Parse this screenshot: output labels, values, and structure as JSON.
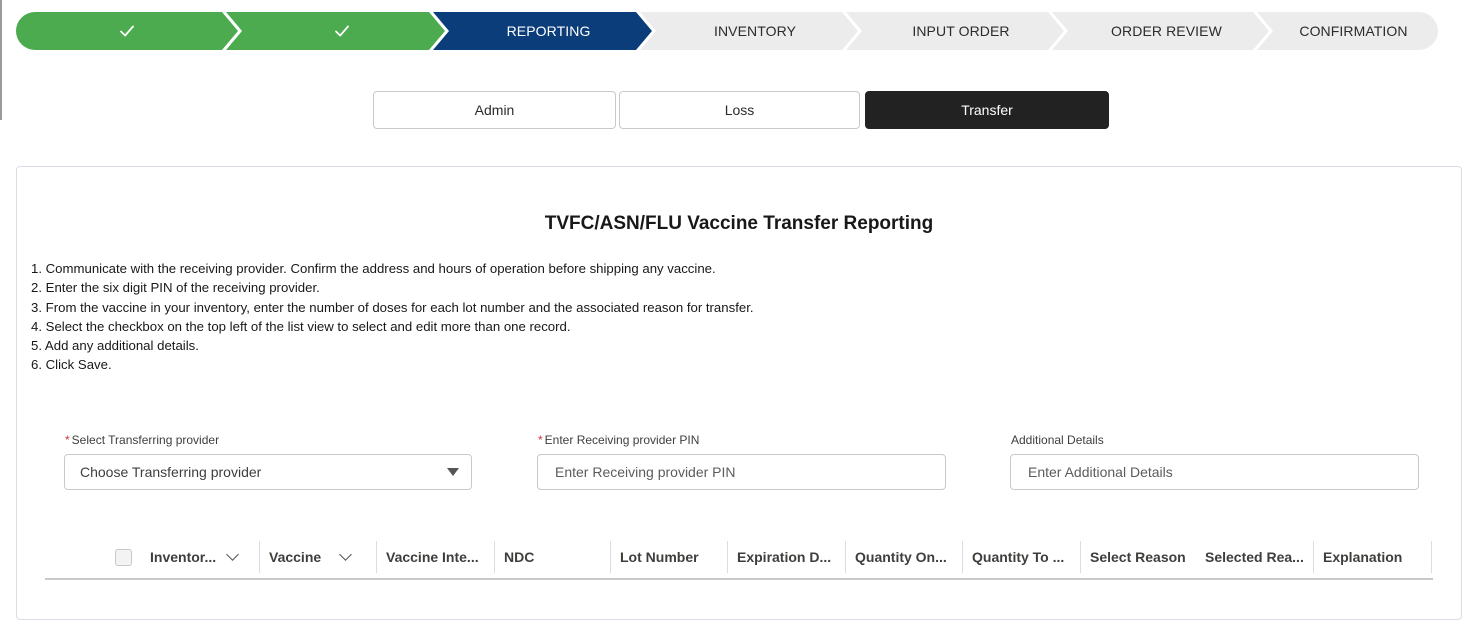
{
  "path": {
    "stages": [
      {
        "label": "",
        "status": "complete",
        "icon": "check-icon"
      },
      {
        "label": "",
        "status": "complete",
        "icon": "check-icon"
      },
      {
        "label": "REPORTING",
        "status": "current"
      },
      {
        "label": "INVENTORY",
        "status": "incomplete"
      },
      {
        "label": "INPUT ORDER",
        "status": "incomplete"
      },
      {
        "label": "ORDER REVIEW",
        "status": "incomplete"
      },
      {
        "label": "CONFIRMATION",
        "status": "incomplete"
      }
    ],
    "colors": {
      "complete": "#4bab4e",
      "current": "#0b3d7a",
      "incomplete": "#ececec"
    }
  },
  "tabs": [
    {
      "label": "Admin",
      "active": false
    },
    {
      "label": "Loss",
      "active": false
    },
    {
      "label": "Transfer",
      "active": true
    }
  ],
  "card": {
    "title": "TVFC/ASN/FLU Vaccine Transfer Reporting",
    "instructions": [
      "1. Communicate with the receiving provider. Confirm the address and hours of operation before shipping any vaccine.",
      "2. Enter the six digit PIN of the receiving provider.",
      "3. From the vaccine in your inventory, enter the number of doses for each lot number and the associated reason for transfer.",
      "4. Select the checkbox on the top left of the list view to select and edit more than one record.",
      "5. Add any additional details.",
      "6. Click Save."
    ]
  },
  "form": {
    "transferring": {
      "required_mark": "*",
      "label": "Select Transferring provider",
      "value": "Choose Transferring provider"
    },
    "receiving_pin": {
      "required_mark": "*",
      "label": "Enter Receiving provider PIN",
      "placeholder": "Enter Receiving provider PIN"
    },
    "details": {
      "label": "Additional Details",
      "placeholder": "Enter Additional Details"
    }
  },
  "table": {
    "columns": [
      {
        "label": "Inventor...",
        "sortable": true
      },
      {
        "label": "Vaccine",
        "sortable": true
      },
      {
        "label": "Vaccine Inte...",
        "sortable": false
      },
      {
        "label": "NDC",
        "sortable": false
      },
      {
        "label": "Lot Number",
        "sortable": false
      },
      {
        "label": "Expiration D...",
        "sortable": false
      },
      {
        "label": "Quantity On...",
        "sortable": false
      },
      {
        "label": "Quantity To ...",
        "sortable": false
      },
      {
        "label": "Select Reason",
        "sortable": false
      },
      {
        "label": "Selected Rea...",
        "sortable": false
      },
      {
        "label": "Explanation",
        "sortable": false
      }
    ]
  }
}
